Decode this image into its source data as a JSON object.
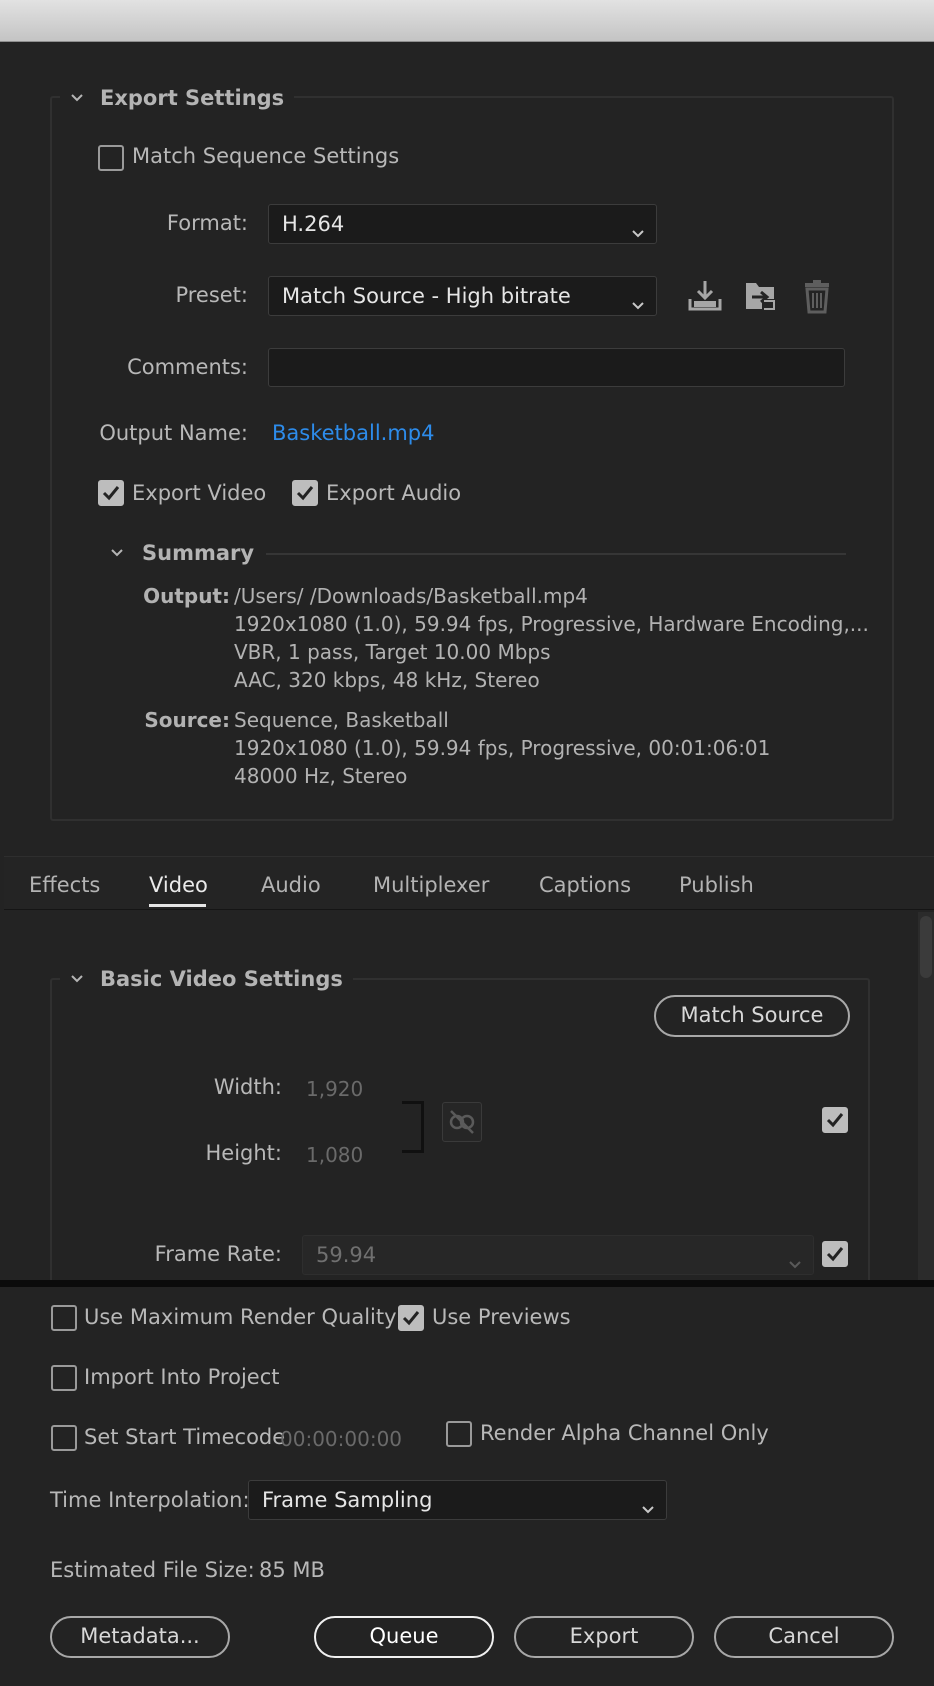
{
  "export_settings": {
    "title": "Export Settings",
    "match_sequence_label": "Match Sequence Settings",
    "format_label": "Format:",
    "format_value": "H.264",
    "preset_label": "Preset:",
    "preset_value": "Match Source - High bitrate",
    "comments_label": "Comments:",
    "comments_value": "",
    "output_name_label": "Output Name:",
    "output_name_value": "Basketball.mp4",
    "export_video_label": "Export Video",
    "export_audio_label": "Export Audio",
    "icons": [
      "save-preset-icon",
      "import-preset-icon",
      "delete-preset-icon"
    ]
  },
  "summary": {
    "title": "Summary",
    "output_label": "Output:",
    "output_lines": [
      "/Users/             /Downloads/Basketball.mp4",
      "1920x1080 (1.0), 59.94 fps, Progressive, Hardware Encoding,...",
      "VBR, 1 pass, Target 10.00 Mbps",
      "AAC, 320 kbps, 48 kHz, Stereo"
    ],
    "source_label": "Source:",
    "source_lines": [
      "Sequence, Basketball",
      "1920x1080 (1.0), 59.94 fps, Progressive, 00:01:06:01",
      "48000 Hz, Stereo"
    ]
  },
  "tabs": [
    "Effects",
    "Video",
    "Audio",
    "Multiplexer",
    "Captions",
    "Publish"
  ],
  "active_tab": "Video",
  "basic_video": {
    "title": "Basic Video Settings",
    "match_source_label": "Match Source",
    "width_label": "Width:",
    "width_value": "1,920",
    "height_label": "Height:",
    "height_value": "1,080",
    "frame_rate_label": "Frame Rate:",
    "frame_rate_value": "59.94"
  },
  "bottom": {
    "max_render_label": "Use Maximum Render Quality",
    "use_previews_label": "Use Previews",
    "import_label": "Import Into Project",
    "start_timecode_label": "Set Start Timecode",
    "start_timecode_value": "00:00:00:00",
    "alpha_label": "Render Alpha Channel Only",
    "time_interp_label": "Time Interpolation:",
    "time_interp_value": "Frame Sampling",
    "file_size_label": "Estimated File Size:",
    "file_size_value": "85 MB",
    "metadata_label": "Metadata...",
    "queue_label": "Queue",
    "export_label": "Export",
    "cancel_label": "Cancel"
  },
  "checks": {
    "match_sequence": false,
    "export_video": true,
    "export_audio": true,
    "resize_checked": true,
    "frame_rate_checked": true,
    "max_render": false,
    "use_previews": true,
    "import_into_project": false,
    "set_start_timecode": false,
    "render_alpha": false
  },
  "colors": {
    "background": "#232323",
    "link": "#2d8ceb",
    "primary_button_border": "#f0f0f0"
  }
}
